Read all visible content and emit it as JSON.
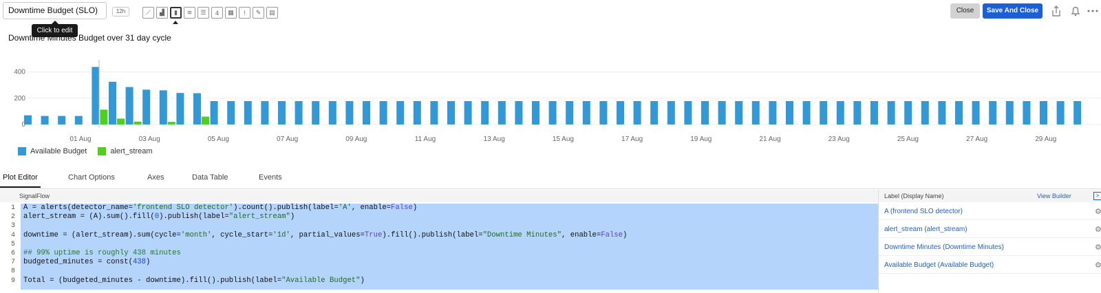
{
  "header": {
    "chart_name": "Downtime Budget (SLO)",
    "time_range": "12h",
    "tooltip": "Click to edit",
    "viz_icons": [
      {
        "name": "line-chart-icon",
        "glyph": "⟋"
      },
      {
        "name": "area-chart-icon",
        "glyph": "▟"
      },
      {
        "name": "column-chart-icon",
        "glyph": "▮"
      },
      {
        "name": "histogram-icon",
        "glyph": "≋"
      },
      {
        "name": "list-icon",
        "glyph": "☰"
      },
      {
        "name": "single-value-icon",
        "glyph": "4"
      },
      {
        "name": "heatmap-icon",
        "glyph": "▦"
      },
      {
        "name": "event-feed-icon",
        "glyph": "!"
      },
      {
        "name": "text-note-icon",
        "glyph": "✎"
      },
      {
        "name": "table-icon",
        "glyph": "▤"
      }
    ],
    "close_label": "Close",
    "save_label": "Save And Close"
  },
  "chart_data": {
    "type": "bar",
    "title": "Downtime Minutes Budget over 31 day cycle",
    "ylim": [
      0,
      450
    ],
    "yticks": [
      0,
      200,
      400
    ],
    "x_tick_labels": [
      "01 Aug",
      "03 Aug",
      "05 Aug",
      "07 Aug",
      "09 Aug",
      "11 Aug",
      "13 Aug",
      "15 Aug",
      "17 Aug",
      "19 Aug",
      "21 Aug",
      "23 Aug",
      "25 Aug",
      "27 Aug",
      "29 Aug"
    ],
    "series": [
      {
        "name": "Available Budget",
        "color": "#3399d6",
        "values": [
          70,
          65,
          65,
          65,
          438,
          325,
          285,
          265,
          260,
          240,
          238,
          178,
          178,
          178,
          178,
          178,
          178,
          178,
          178,
          178,
          178,
          178,
          178,
          178,
          178,
          178,
          178,
          178,
          178,
          178,
          178,
          178,
          178,
          178,
          178,
          178,
          178,
          178,
          178,
          178,
          178,
          178,
          178,
          178,
          178,
          178,
          178,
          178,
          178,
          178,
          178,
          178,
          178,
          178,
          178,
          178,
          178,
          178,
          178,
          178,
          178,
          178,
          178
        ]
      },
      {
        "name": "alert_stream",
        "color": "#4fcf1f",
        "values": [
          0,
          0,
          0,
          0,
          113,
          45,
          22,
          0,
          20,
          0,
          60,
          0,
          0,
          0,
          0,
          0,
          0,
          0,
          0,
          0,
          0,
          0,
          0,
          0,
          0,
          0,
          0,
          0,
          0,
          0,
          0,
          0,
          0,
          0,
          0,
          0,
          0,
          0,
          0,
          0,
          0,
          0,
          0,
          0,
          0,
          0,
          0,
          0,
          0,
          0,
          0,
          0,
          0,
          0,
          0,
          0,
          0,
          0,
          0,
          0,
          0,
          0,
          0
        ]
      }
    ],
    "legend": "bottom-left"
  },
  "tabs": [
    "Plot Editor",
    "Chart Options",
    "Axes",
    "Data Table",
    "Events"
  ],
  "editor": {
    "header": "SignalFlow",
    "lines": [
      [
        [
          "",
          "A = alerts(detector_name="
        ],
        [
          "str",
          "'frontend SLO detector'"
        ],
        [
          "",
          ").count().publish(label="
        ],
        [
          "str",
          "'A'"
        ],
        [
          "",
          ", enable="
        ],
        [
          "kw",
          "False"
        ],
        [
          "",
          ")"
        ]
      ],
      [
        [
          "",
          "alert_stream = (A).sum().fill("
        ],
        [
          "num",
          "0"
        ],
        [
          "",
          ").publish(label="
        ],
        [
          "str",
          "\"alert_stream\""
        ],
        [
          "",
          ")"
        ]
      ],
      [],
      [
        [
          "",
          "downtime = (alert_stream).sum(cycle="
        ],
        [
          "str",
          "'month'"
        ],
        [
          "",
          ", cycle_start="
        ],
        [
          "str",
          "'1d'"
        ],
        [
          "",
          ", partial_values="
        ],
        [
          "kw",
          "True"
        ],
        [
          "",
          ").fill().publish(label="
        ],
        [
          "str",
          "\"Downtime Minutes\""
        ],
        [
          "",
          ", enable="
        ],
        [
          "kw",
          "False"
        ],
        [
          "",
          ")"
        ]
      ],
      [],
      [
        [
          "cmt",
          "## 99% uptime is roughly 438 minutes"
        ]
      ],
      [
        [
          "",
          "budgeted_minutes = const("
        ],
        [
          "num",
          "438"
        ],
        [
          "",
          ")"
        ]
      ],
      [],
      [
        [
          "",
          "Total = (budgeted_minutes - downtime).fill().publish(label="
        ],
        [
          "str",
          "\"Available Budget\""
        ],
        [
          "",
          ")"
        ]
      ]
    ]
  },
  "labels_panel": {
    "header": "Label (Display Name)",
    "view_builder": "View Builder",
    "rows": [
      "A (frontend SLO detector)",
      "alert_stream (alert_stream)",
      "Downtime Minutes (Downtime Minutes)",
      "Available Budget (Available Budget)"
    ]
  }
}
